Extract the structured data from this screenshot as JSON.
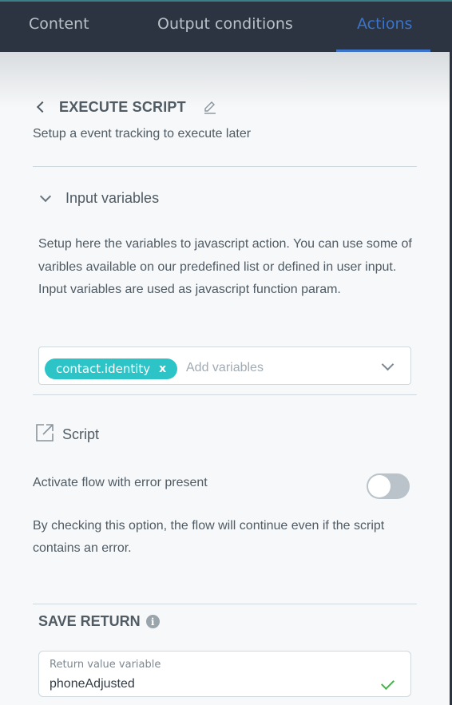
{
  "tabs": [
    {
      "label": "Content"
    },
    {
      "label": "Output conditions"
    },
    {
      "label": "Actions",
      "active": true
    }
  ],
  "header": {
    "title": "EXECUTE SCRIPT",
    "subtitle": "Setup a event tracking to execute later"
  },
  "input_variables": {
    "label": "Input variables",
    "description": "Setup here the variables to javascript action. You can use some of varibles available on our predefined list or defined in user input. Input variables are used as javascript function param.",
    "chip": "contact.identity",
    "chip_close": "x",
    "placeholder": "Add variables"
  },
  "script": {
    "label": "Script"
  },
  "activate_flow": {
    "label": "Activate flow with error present",
    "toggle_on": false,
    "description": "By checking this option, the flow will continue even if the script contains an error."
  },
  "save_return": {
    "title": "SAVE RETURN",
    "info": "i",
    "field_label": "Return value variable",
    "field_value": "phoneAdjusted"
  },
  "colors": {
    "topbar": "#2b3440",
    "active_tab": "#3b74c9",
    "chip": "#2cc4c6",
    "check": "#4caf50"
  }
}
